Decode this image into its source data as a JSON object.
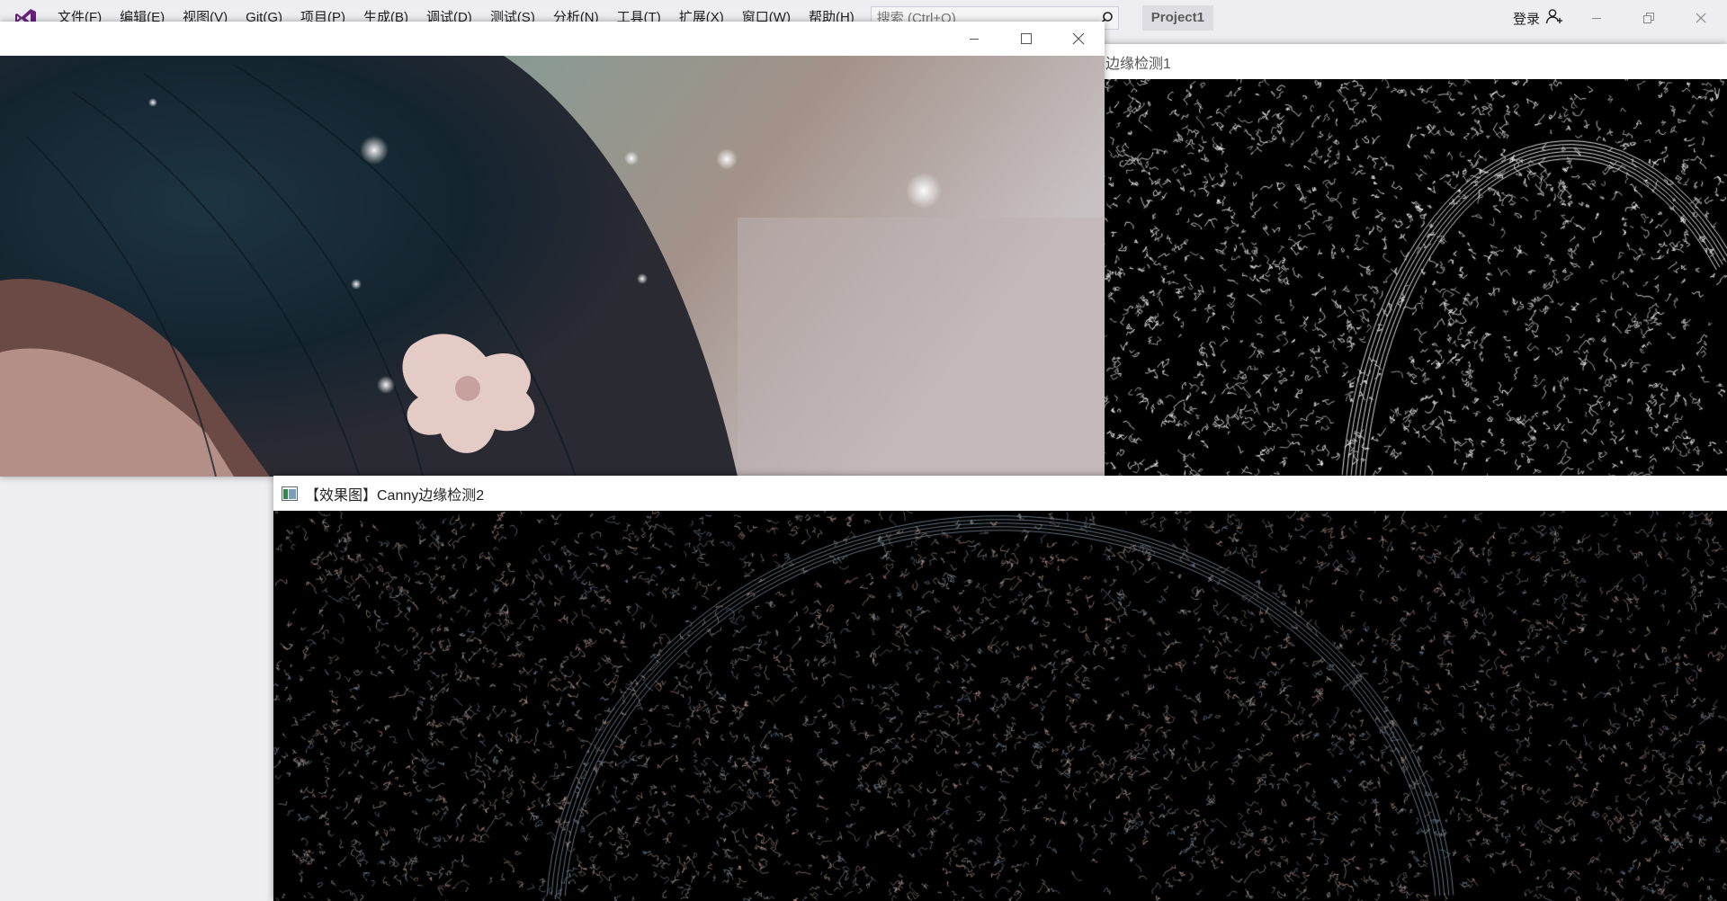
{
  "menubar": {
    "items": [
      "文件(F)",
      "编辑(E)",
      "视图(V)",
      "Git(G)",
      "项目(P)",
      "生成(B)",
      "调试(D)",
      "测试(S)",
      "分析(N)",
      "工具(T)",
      "扩展(X)",
      "窗口(W)",
      "帮助(H)"
    ],
    "search_placeholder": "搜索 (Ctrl+Q)",
    "project_name": "Project1",
    "login_label": "登录"
  },
  "windows": {
    "edge1_title": "边缘检测1",
    "edge2_title": "【效果图】Canny边缘检测2"
  },
  "colors": {
    "vs_chrome": "#eeeef2",
    "vs_accent": "#68217a",
    "edge1_lines": "#e6e6e6",
    "edge2_lines_warm": "#c9a59a",
    "edge2_lines_cool": "#7a8ea0"
  },
  "icons": [
    "vs-logo-icon",
    "search-icon",
    "user-add-icon",
    "minimize-icon",
    "restore-icon",
    "maximize-icon",
    "close-icon",
    "opencv-window-icon"
  ]
}
